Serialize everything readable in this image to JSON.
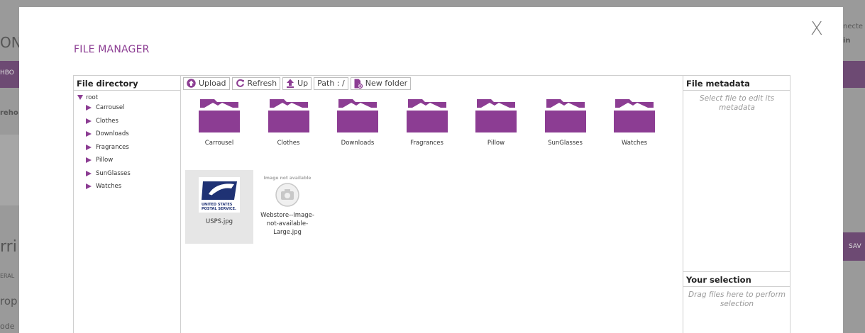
{
  "background": {
    "left_text_1": "ON",
    "left_text_2": "HBO",
    "left_text_3": "reho",
    "left_text_4": "rri",
    "left_text_5": "ERAL",
    "left_text_6": "rop",
    "left_text_7": "ode",
    "right_text_1": "necte",
    "right_text_2": "in",
    "right_text_3": "SAV"
  },
  "modal": {
    "title": "FILE MANAGER",
    "close_label": "X"
  },
  "directory": {
    "header": "File directory",
    "root_label": "root",
    "items": [
      {
        "label": "Carrousel"
      },
      {
        "label": "Clothes"
      },
      {
        "label": "Downloads"
      },
      {
        "label": "Fragrances"
      },
      {
        "label": "Pillow"
      },
      {
        "label": "SunGlasses"
      },
      {
        "label": "Watches"
      }
    ]
  },
  "toolbar": {
    "upload_label": "Upload",
    "refresh_label": "Refresh",
    "up_label": "Up",
    "path_label": "Path : /",
    "new_folder_label": "New folder"
  },
  "folders": [
    {
      "name": "Carrousel"
    },
    {
      "name": "Clothes"
    },
    {
      "name": "Downloads"
    },
    {
      "name": "Fragrances"
    },
    {
      "name": "Pillow"
    },
    {
      "name": "SunGlasses"
    },
    {
      "name": "Watches"
    }
  ],
  "files": [
    {
      "name": "USPS.jpg",
      "logo_text_1": "UNITED STATES",
      "logo_text_2": "POSTAL SERVICE."
    },
    {
      "name_line1": "Webstore--Image-",
      "name_line2": "not-available-",
      "name_line3": "Large.jpg",
      "placeholder_text": "Image not available"
    }
  ],
  "metadata": {
    "header": "File metadata",
    "hint": "Select file to edit its metadata"
  },
  "selection": {
    "header": "Your selection",
    "hint": "Drag files here to perform selection"
  },
  "colors": {
    "accent": "#8c3d93",
    "border": "#cfcfcf",
    "overlay": "#9a9a9a"
  }
}
